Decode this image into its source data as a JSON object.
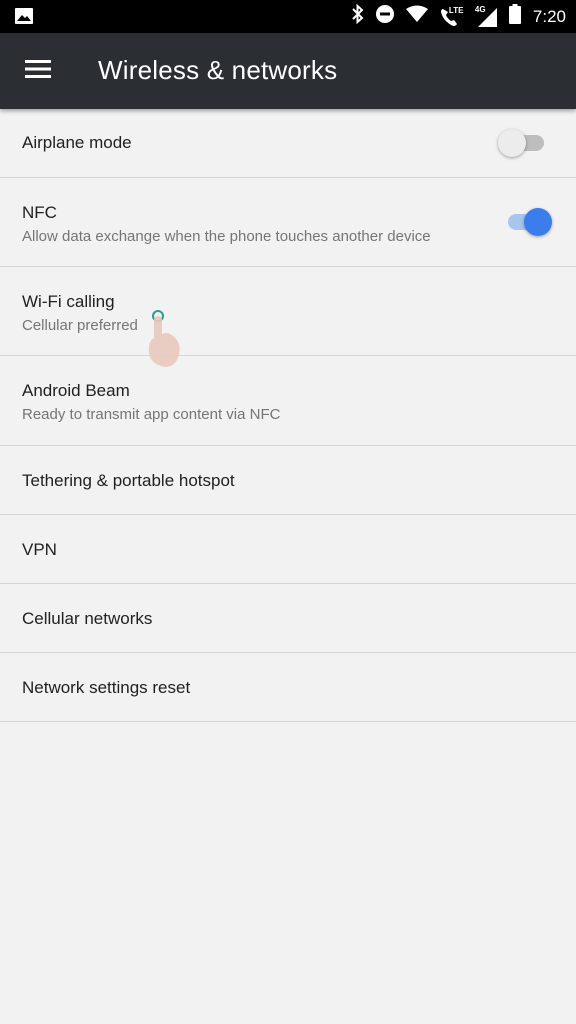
{
  "status_bar": {
    "time": "7:20",
    "network_label_lte": "LTE",
    "network_label_4g": "4G",
    "icons": [
      "gallery-icon",
      "bluetooth-icon",
      "do-not-disturb-icon",
      "wifi-icon",
      "lte-call-icon",
      "signal-icon",
      "battery-icon"
    ]
  },
  "toolbar": {
    "title": "Wireless & networks",
    "menu_icon": "hamburger-menu-icon"
  },
  "items": [
    {
      "title": "Airplane mode",
      "subtitle": "",
      "switch": "off"
    },
    {
      "title": "NFC",
      "subtitle": "Allow data exchange when the phone touches another device",
      "switch": "on"
    },
    {
      "title": "Wi-Fi calling",
      "subtitle": "Cellular preferred"
    },
    {
      "title": "Android Beam",
      "subtitle": "Ready to transmit app content via NFC"
    },
    {
      "title": "Tethering & portable hotspot",
      "subtitle": ""
    },
    {
      "title": "VPN",
      "subtitle": ""
    },
    {
      "title": "Cellular networks",
      "subtitle": ""
    },
    {
      "title": "Network settings reset",
      "subtitle": ""
    }
  ],
  "colors": {
    "toolbar": "#2b2f33",
    "background": "#f2f2f2",
    "accent": "#3b7ded"
  }
}
